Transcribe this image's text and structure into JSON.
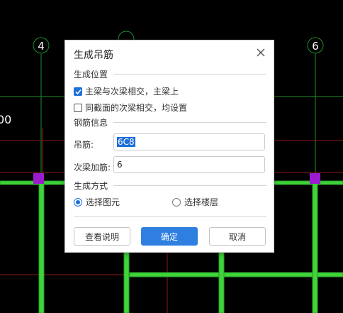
{
  "canvas": {
    "axis_labels": [
      "4",
      "6"
    ],
    "dimension_fragment": "00",
    "colors": {
      "background": "#000000",
      "beam": "#3fd43a",
      "beam_edge": "#2a9d27",
      "axis_line": "#1f8f2a",
      "red_line": "#8b1a1a",
      "node": "#9b1ccf"
    }
  },
  "dialog": {
    "title": "生成吊筋",
    "close_icon": "close-icon",
    "position_section": {
      "label": "生成位置",
      "options": [
        {
          "label": "主梁与次梁相交，主梁上",
          "checked": true
        },
        {
          "label": "同截面的次梁相交，均设置",
          "checked": false
        }
      ]
    },
    "rebar_section": {
      "label": "钢筋信息",
      "hanger_label": "吊筋:",
      "hanger_value": "6C8",
      "extra_label": "次梁加筋:",
      "extra_value": "6"
    },
    "method_section": {
      "label": "生成方式",
      "options": [
        {
          "label": "选择图元",
          "selected": true
        },
        {
          "label": "选择楼层",
          "selected": false
        }
      ]
    },
    "buttons": {
      "help": "查看说明",
      "ok": "确定",
      "cancel": "取消"
    },
    "accent_color": "#2f7fe0"
  }
}
